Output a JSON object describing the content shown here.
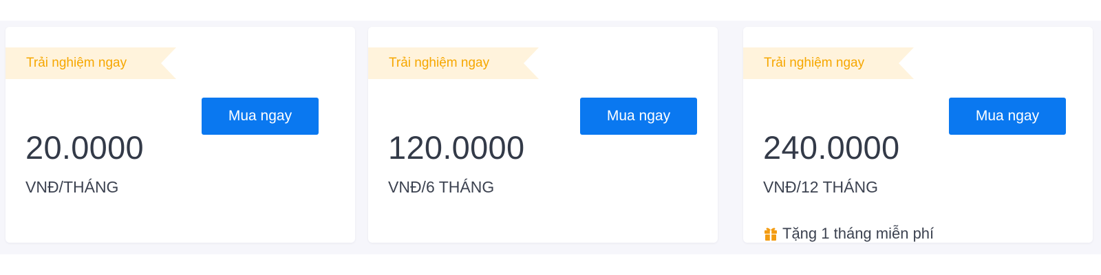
{
  "colors": {
    "ribbon_bg": "#fff3dc",
    "ribbon_text": "#f6a700",
    "button_bg": "#0a78f0",
    "price_text": "#333a48",
    "page_band": "#f6f6fb"
  },
  "plans": [
    {
      "ribbon": "Trải nghiệm ngay",
      "price": "20.0000",
      "period": "VNĐ/THÁNG",
      "button": "Mua ngay"
    },
    {
      "ribbon": "Trải nghiệm ngay",
      "price": "120.0000",
      "period": "VNĐ/6 THÁNG",
      "button": "Mua ngay"
    },
    {
      "ribbon": "Trải nghiệm ngay",
      "price": "240.0000",
      "period": "VNĐ/12 THÁNG",
      "button": "Mua ngay",
      "bonus": {
        "icon": "gift-icon",
        "text": "Tặng 1 tháng miễn phí"
      }
    }
  ]
}
